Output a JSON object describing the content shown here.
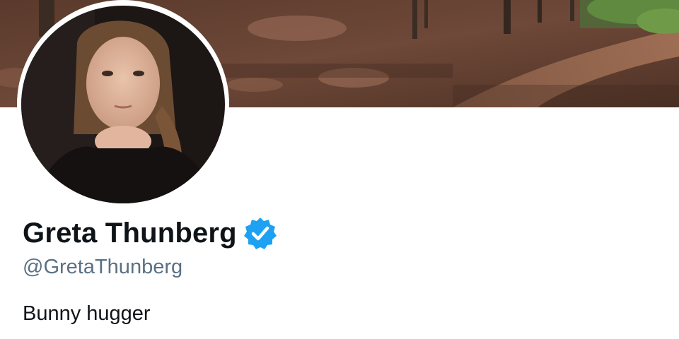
{
  "profile": {
    "display_name": "Greta Thunberg",
    "handle": "@GretaThunberg",
    "bio": "Bunny hugger",
    "verified": true
  },
  "banner": {
    "icon": "forest-path-photo"
  },
  "avatar": {
    "icon": "profile-photo"
  },
  "colors": {
    "verified_badge": "#1da1f2",
    "name_text": "#0f1419",
    "handle_text": "#5b7083",
    "background": "#ffffff"
  }
}
